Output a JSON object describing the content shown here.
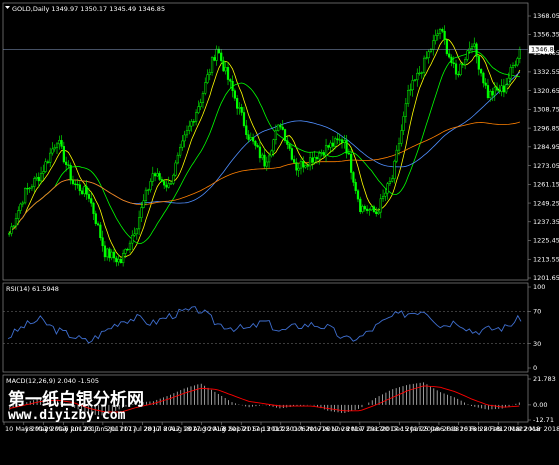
{
  "chart_data": [
    {
      "type": "candlestick",
      "title": "GOLD,Daily  1349.97 1350.17 1345.49 1346.85",
      "symbol": "GOLD",
      "timeframe": "Daily",
      "ohlc_header": {
        "open": 1349.97,
        "high": 1350.17,
        "low": 1345.49,
        "close": 1346.85
      },
      "current_price": "1346.85",
      "y_ticks": [
        "1368.05",
        "1356.35",
        "1344.65",
        "1332.55",
        "1320.65",
        "1308.75",
        "1296.85",
        "1284.95",
        "1273.05",
        "1261.15",
        "1249.25",
        "1237.35",
        "1225.45",
        "1213.55",
        "1201.65"
      ],
      "ylim": [
        1201.65,
        1368.05
      ],
      "close_path": [
        [
          "10 May 2017",
          1230
        ],
        [
          "18 May 2017",
          1256
        ],
        [
          "29 May 2017",
          1268
        ],
        [
          "6 Jun 2017",
          1290
        ],
        [
          "14 Jun 2017",
          1262
        ],
        [
          "23 Jun 2017",
          1254
        ],
        [
          "5 Jul 2017",
          1218
        ],
        [
          "10 Jul 2017",
          1212
        ],
        [
          "18 Jul 2017",
          1236
        ],
        [
          "28 Jul 2017",
          1268
        ],
        [
          "8 Aug 2017",
          1260
        ],
        [
          "18 Aug 2017",
          1290
        ],
        [
          "30 Aug 2017",
          1315
        ],
        [
          "8 Sep 2017",
          1348
        ],
        [
          "15 Sep 2017",
          1320
        ],
        [
          "25 Sep 2017",
          1292
        ],
        [
          "5 Oct 2017",
          1275
        ],
        [
          "13 Oct 2017",
          1300
        ],
        [
          "25 Oct 2017",
          1272
        ],
        [
          "6 Nov 2017",
          1278
        ],
        [
          "16 Nov 2017",
          1285
        ],
        [
          "27 Nov 2017",
          1290
        ],
        [
          "7 Dec 2017",
          1247
        ],
        [
          "12 Dec 2017",
          1243
        ],
        [
          "20 Dec 2017",
          1265
        ],
        [
          "4 Jan 2018",
          1318
        ],
        [
          "15 Jan 2018",
          1338
        ],
        [
          "25 Jan 2018",
          1360
        ],
        [
          "6 Feb 2018",
          1330
        ],
        [
          "16 Feb 2018",
          1352
        ],
        [
          "28 Feb 2018",
          1318
        ],
        [
          "12 Mar 2018",
          1322
        ],
        [
          "22 Mar 2018",
          1347
        ]
      ],
      "moving_averages": [
        {
          "color": "#ffff00"
        },
        {
          "color": "#00ff00"
        },
        {
          "color": "#4f8fff"
        },
        {
          "color": "#ff8000"
        }
      ],
      "colors": {
        "candle": "#00ff00",
        "background": "#000000",
        "grid": "#444444"
      }
    },
    {
      "type": "line",
      "title": "RSI(14) 61.5948",
      "ylim": [
        0,
        100
      ],
      "y_ticks": [
        "100",
        "70",
        "30",
        "0"
      ],
      "levels": [
        70,
        30
      ],
      "color": "#3f6fd0",
      "values": [
        38,
        52,
        60,
        47,
        40,
        32,
        45,
        58,
        62,
        55,
        64,
        70,
        72,
        55,
        50,
        48,
        58,
        45,
        52,
        54,
        50,
        35,
        38,
        52,
        64,
        68,
        72,
        52,
        58,
        45,
        48,
        50,
        62
      ]
    },
    {
      "type": "bar",
      "title": "MACD(12,26,9) 2.040 -1.505",
      "ylim": [
        -12.71,
        21.78
      ],
      "y_ticks": [
        "21.783",
        "0.00",
        "-12.71"
      ],
      "histogram": [
        -4,
        2,
        6,
        4,
        -2,
        -8,
        -9,
        -3,
        2,
        3,
        8,
        14,
        18,
        10,
        2,
        -2,
        0,
        -3,
        -1,
        0,
        -5,
        -7,
        -3,
        6,
        13,
        17,
        19,
        11,
        6,
        -1,
        -4,
        -3,
        2
      ],
      "signal": [
        -3,
        0,
        3,
        4,
        2,
        -3,
        -6,
        -6,
        -2,
        1,
        5,
        10,
        14,
        13,
        8,
        3,
        1,
        -1,
        -1,
        -1,
        -3,
        -5,
        -5,
        0,
        6,
        12,
        16,
        15,
        11,
        5,
        0,
        -2,
        -1
      ],
      "colors": {
        "histogram": "#c0c0c0",
        "signal": "#ff0000"
      }
    }
  ],
  "x_labels": [
    "10 May 2017",
    "18 May 2017",
    "29 May 2017",
    "6 Jun 2017",
    "23 Jun 2017",
    "5 Jul 2017",
    "17 Jul 2017",
    "28 Jul 2017",
    "8 Aug 2017",
    "18 Aug 2017",
    "30 Aug 2017",
    "8 Sep 2017",
    "21 Sep 2017",
    "13 Oct 2017",
    "25 Oct 2017",
    "6 Nov 2017",
    "16 Nov 2017",
    "28 Nov 2017",
    "7 Dec 2017",
    "20 Dec 2017",
    "15 Jan 2018",
    "25 Jan 2018",
    "6 Feb 2018",
    "16 Feb 2018",
    "28 Feb 2018",
    "12 Mar 2018",
    "22 Mar 2018"
  ],
  "watermark": {
    "line1": "第一纸白银分析网",
    "line2": "www.diyizby.com"
  }
}
